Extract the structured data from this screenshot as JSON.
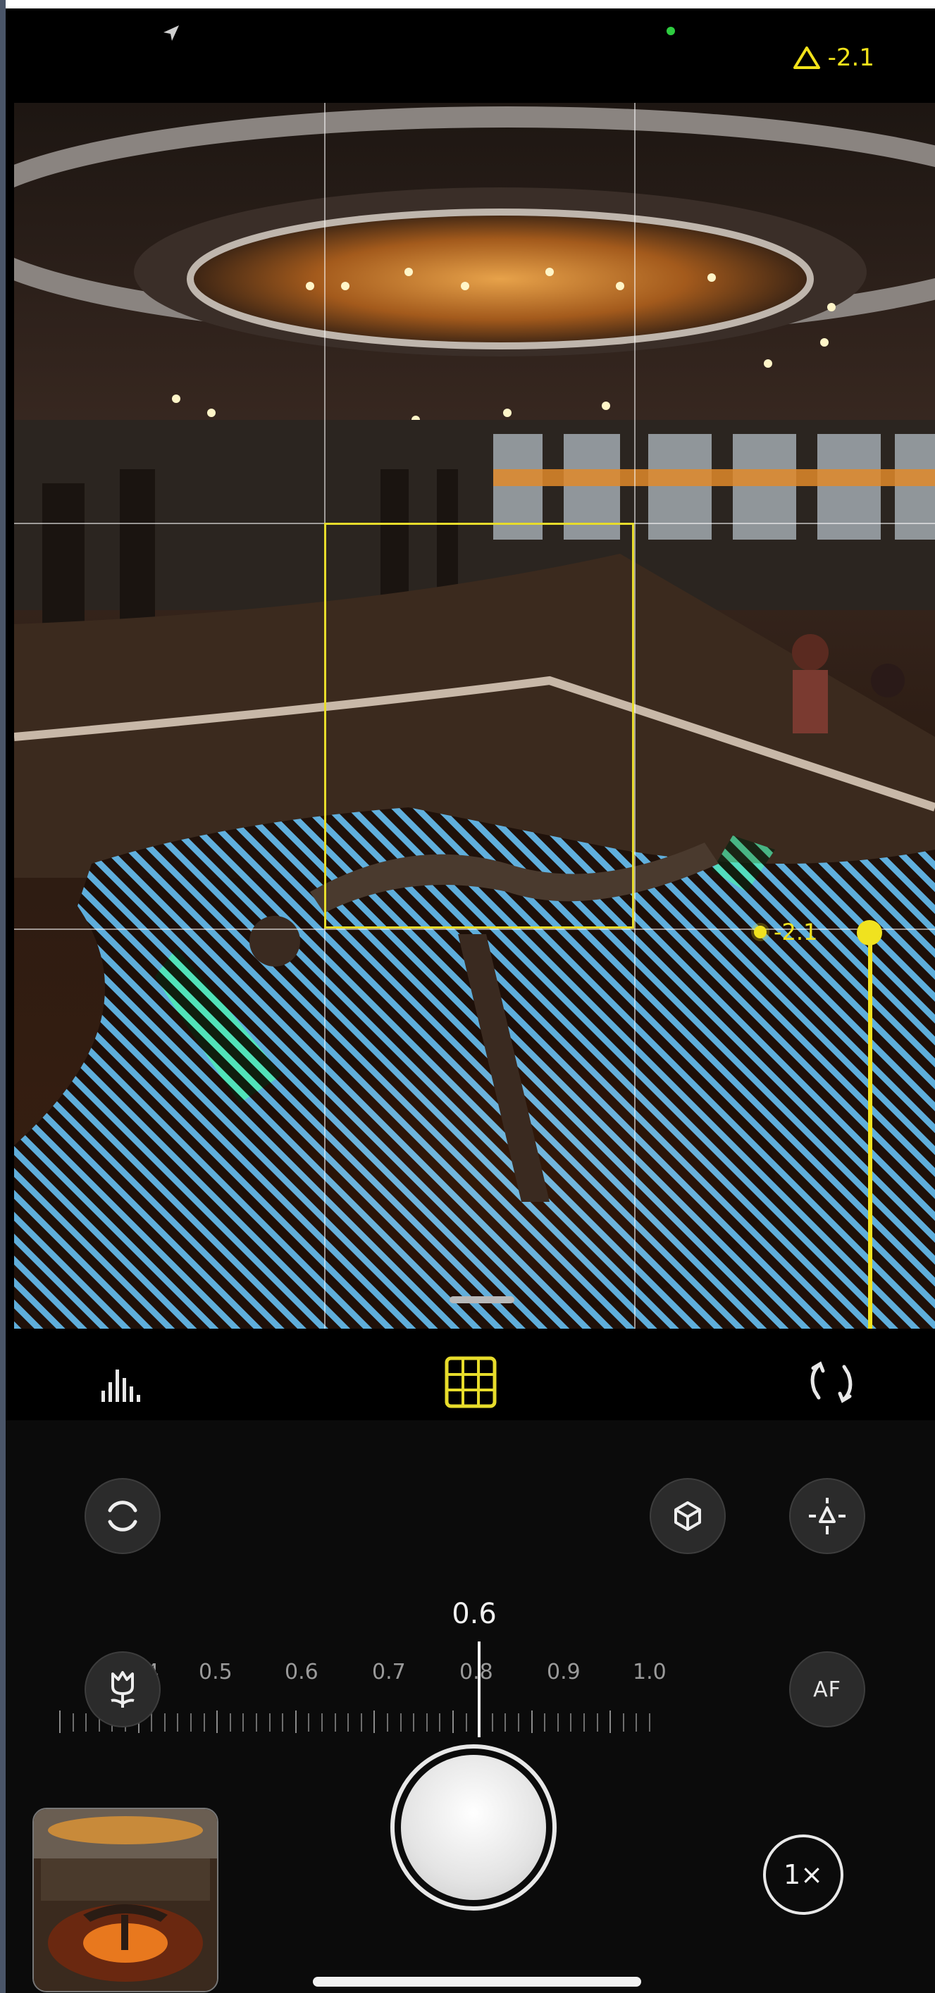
{
  "status_bar": {
    "exposure_readout": "-2.1",
    "location_icon": "navigation-arrow-icon",
    "camera_in_use_dot_color": "#2ecc40"
  },
  "viewfinder": {
    "exposure_marker_value": "-2.1",
    "accent_color": "#f0e21f",
    "zebra_color": "#66c7ff"
  },
  "toolbar": {
    "left_icon": "histogram-icon",
    "center_icon": "grid-icon",
    "right_icon": "flip-camera-icon"
  },
  "controls": {
    "left_top_icon": "ring-icon",
    "right_top_icons": [
      "cube-icon",
      "exposure-lock-icon"
    ],
    "macro_icon": "tulip-macro-icon",
    "af_label": "AF",
    "focus_value": "0.6",
    "focus_scale_labels": [
      "0.4",
      "0.5",
      "0.6",
      "0.7",
      "0.8",
      "0.9",
      "1.0"
    ],
    "zoom_label": "1×"
  }
}
